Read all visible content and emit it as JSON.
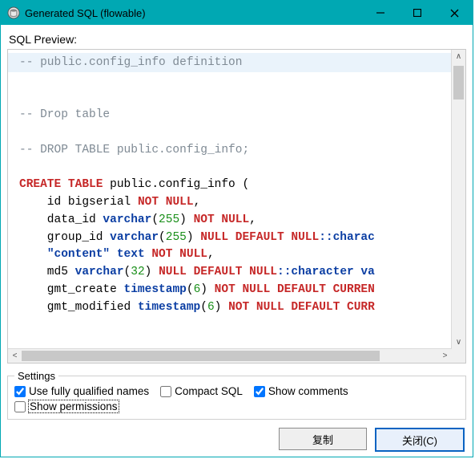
{
  "window": {
    "title": "Generated SQL (flowable)"
  },
  "preview_label": "SQL Preview:",
  "sql": {
    "l1": "-- public.config_info definition",
    "l2": "-- Drop table",
    "l3": "-- DROP TABLE public.config_info;",
    "create_kw": "CREATE TABLE",
    "create_name": " public.config_info (",
    "col_id_pre": "    id bigserial ",
    "not_null": "NOT NULL",
    "comma": ",",
    "col_data_pre": "    data_id ",
    "ty_varchar": "varchar",
    "p255": "255",
    "col_group_pre": "    group_id ",
    "null_default_null": "NULL DEFAULT NULL",
    "cast_char": "::charac",
    "cast_char2": "::character va",
    "col_content_pre": "    ",
    "content_q": "\"content\"",
    "ty_text": "text",
    "col_md5_pre": "    md5 ",
    "p32": "32",
    "col_gmtc_pre": "    gmt_create ",
    "ty_ts": "timestamp",
    "p6": "6",
    "not_null_default_curr": "NOT NULL DEFAULT CURREN",
    "col_gmtm_pre": "    gmt_modified ",
    "not_null_default_curr2": "NOT NULL DEFAULT CURR"
  },
  "settings": {
    "legend": "Settings",
    "fully_qualified": "Use fully qualified names",
    "compact": "Compact SQL",
    "show_comments": "Show comments",
    "show_permissions": "Show permissions"
  },
  "buttons": {
    "copy": "复制",
    "close": "关闭(C)"
  }
}
